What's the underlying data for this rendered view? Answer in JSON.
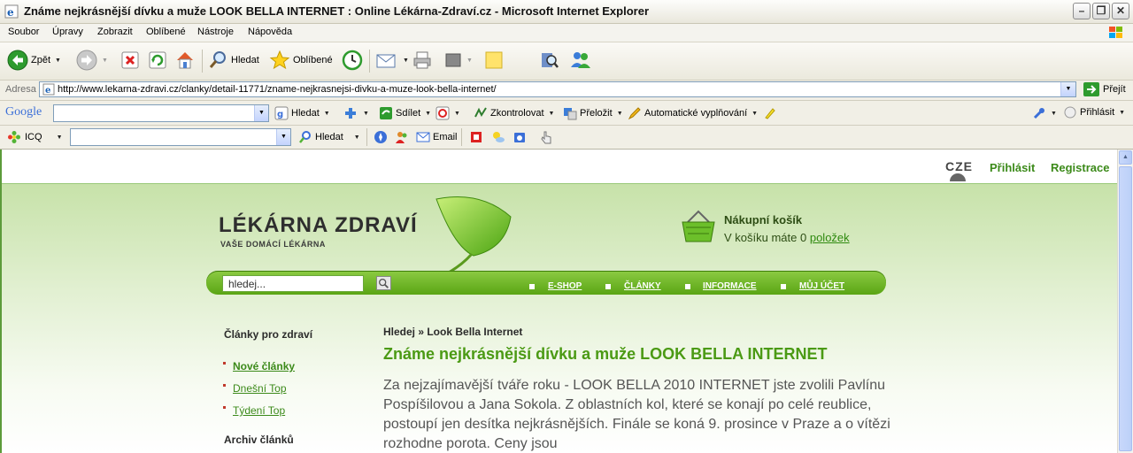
{
  "window": {
    "title": "Známe nejkrásnější dívku a muže LOOK BELLA INTERNET : Online Lékárna-Zdraví.cz - Microsoft Internet Explorer"
  },
  "menu": [
    "Soubor",
    "Úpravy",
    "Zobrazit",
    "Oblíbené",
    "Nástroje",
    "Nápověda"
  ],
  "toolbar": {
    "back": "Zpět",
    "search": "Hledat",
    "favorites": "Oblíbené"
  },
  "address": {
    "label": "Adresa",
    "url": "http://www.lekarna-zdravi.cz/clanky/detail-11771/zname-nejkrasnejsi-divku-a-muze-look-bella-internet/",
    "go": "Přejít"
  },
  "googlebar": {
    "logo": "Google",
    "search": "Hledat",
    "share": "Sdílet",
    "check": "Zkontrolovat",
    "translate": "Přeložit",
    "autofill": "Automatické vyplňování",
    "signin": "Přihlásit"
  },
  "icqbar": {
    "icq": "ICQ",
    "search": "Hledat",
    "email": "Email"
  },
  "site": {
    "lang": "CZE",
    "login": "Přihlásit",
    "register": "Registrace",
    "logo": "LÉKÁRNA ZDRAVÍ",
    "tagline": "VAŠE DOMÁCÍ LÉKÁRNA",
    "cart_title": "Nákupní košík",
    "cart_text": "V košíku máte 0",
    "cart_link": "položek",
    "search_value": "hledej...",
    "nav": [
      "E-SHOP",
      "ČLÁNKY",
      "INFORMACE",
      "MŮJ ÚČET"
    ],
    "sidebar": {
      "heading": "Články pro zdraví",
      "links": [
        "Nové články",
        "Dnešní Top",
        "Týdení Top"
      ],
      "heading2": "Archiv článků"
    },
    "breadcrumb": "Hledej » Look Bella Internet",
    "article_title": "Známe nejkrásnější dívku a muže LOOK BELLA INTERNET",
    "article_text": "Za nejzajímavější tváře roku - LOOK BELLA 2010 INTERNET jste zvolili Pavlínu Pospíšilovou a Jana Sokola. Z oblastních kol, které se konají po celé reublice, postoupí jen desítka nejkrásnějších. Finále se koná 9. prosince v Praze a o vítězi rozhodne porota. Ceny jsou"
  }
}
